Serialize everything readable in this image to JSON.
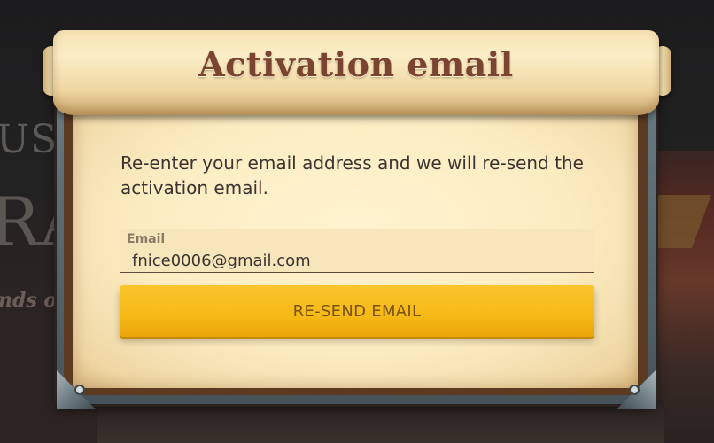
{
  "dialog": {
    "title": "Activation email",
    "message": "Re-enter your email address and we will re-send the activation email.",
    "email_label": "Email",
    "email_value": "fnice0006@gmail.com",
    "resend_label": "RE-SEND EMAIL"
  },
  "background": {
    "partial_text_1": "US",
    "partial_text_2": "RA",
    "partial_text_3": "nds of"
  },
  "colors": {
    "title": "#7a4430",
    "button": "#f6b915",
    "button_text": "#7a5218",
    "parchment": "#fcecc2"
  }
}
